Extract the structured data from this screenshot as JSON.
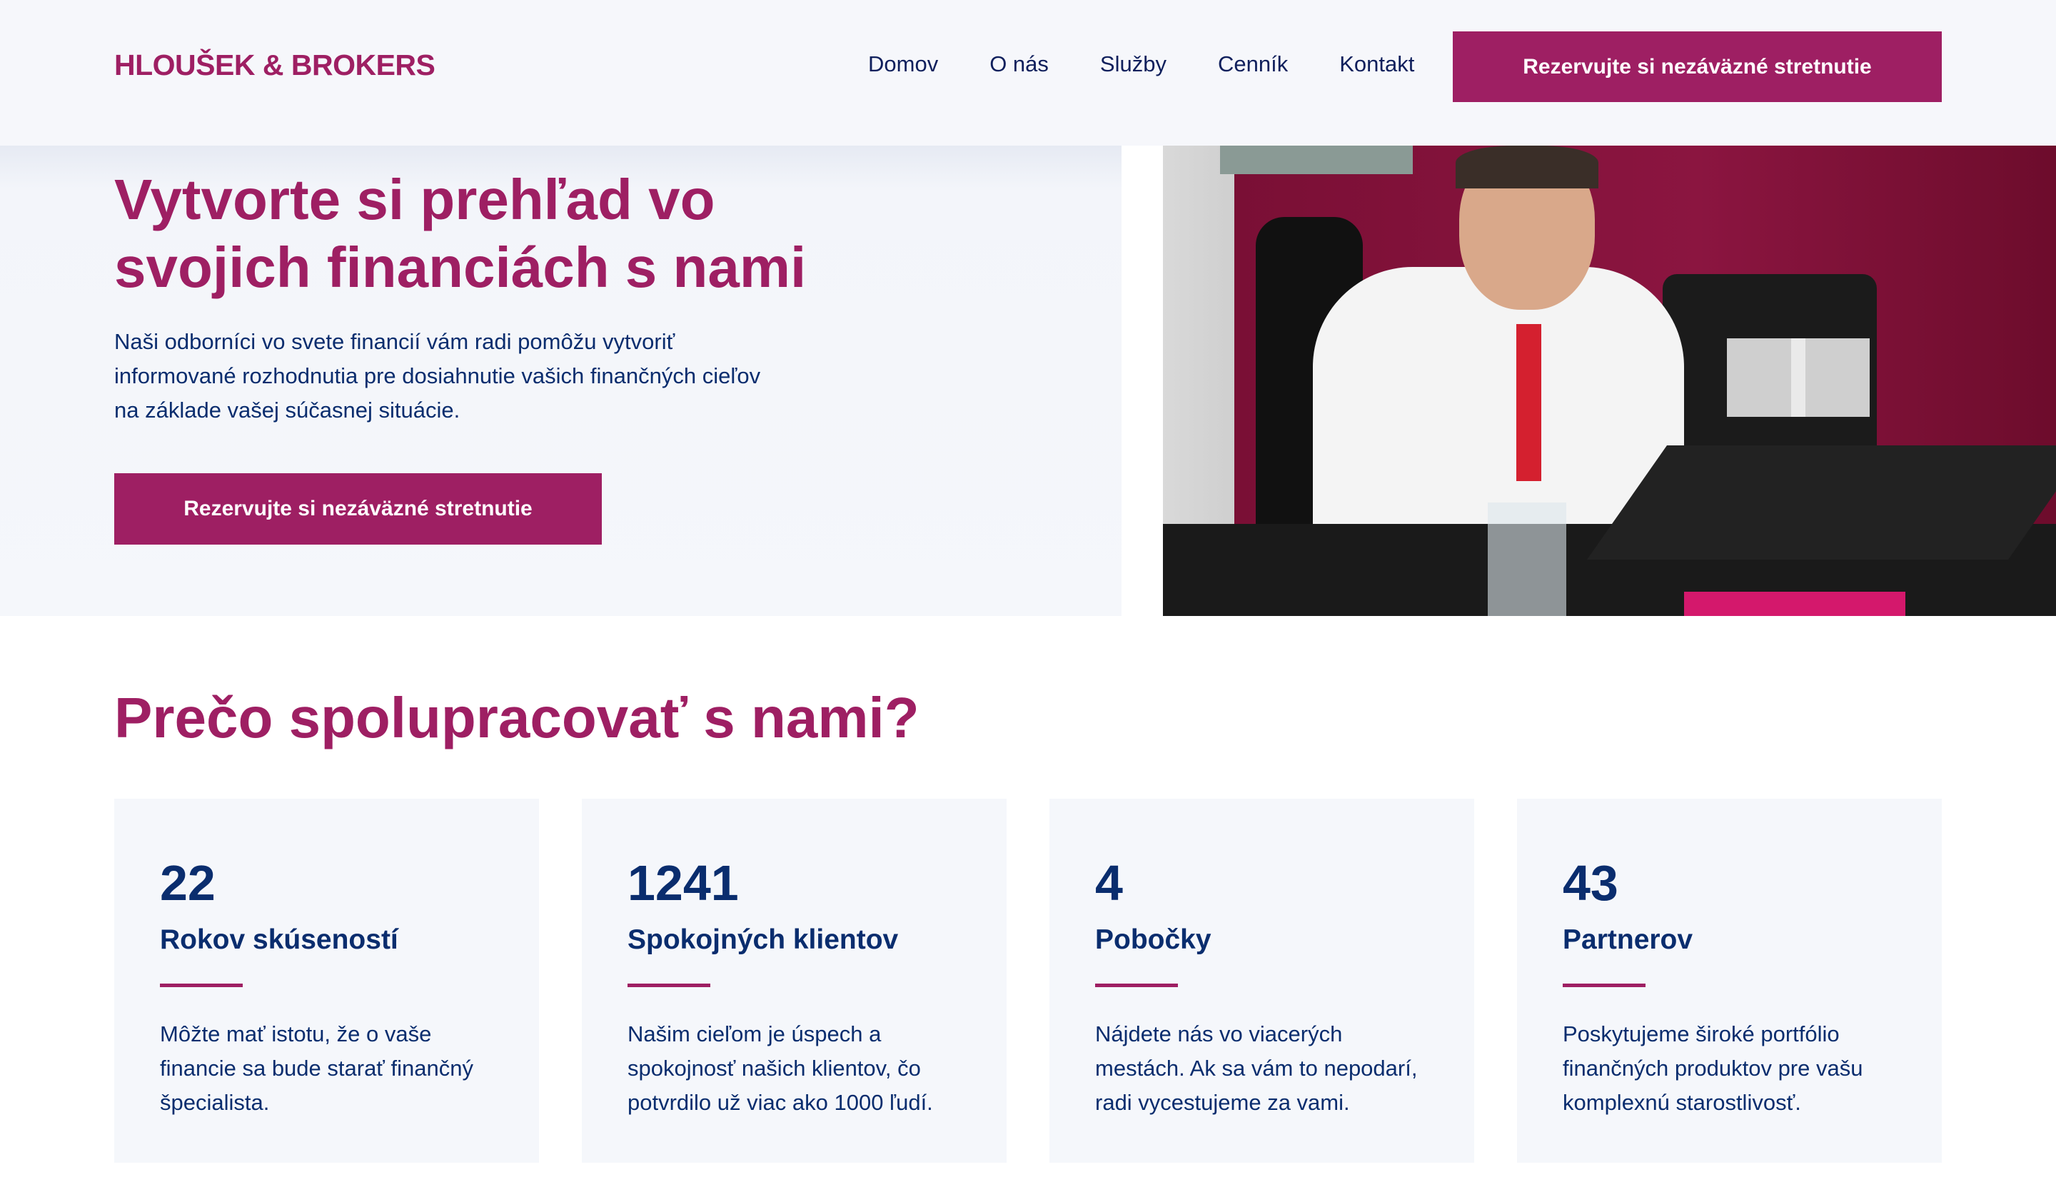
{
  "header": {
    "logo": "HLOUŠEK & BROKERS",
    "nav": [
      "Domov",
      "O nás",
      "Služby",
      "Cenník",
      "Kontakt"
    ],
    "cta": "Rezervujte si nezáväzné stretnutie"
  },
  "hero": {
    "title": "Vytvorte si prehľad vo svojich financiách s nami",
    "text": "Naši odborníci vo svete financií vám radi pomôžu vytvoriť informované rozhodnutia pre dosiahnutie vašich finančných cieľov na základe vašej súčasnej situácie.",
    "cta": "Rezervujte si nezáväzné stretnutie"
  },
  "why": {
    "title": "Prečo spolupracovať s nami?",
    "cards": [
      {
        "number": "22",
        "title": "Rokov skúseností",
        "text": "Môžte mať istotu, že o vaše financie sa bude starať finančný špecialista."
      },
      {
        "number": "1241",
        "title": "Spokojných klientov",
        "text": "Našim cieľom je úspech a spokojnosť našich klientov, čo potvrdilo už viac ako 1000 ľudí."
      },
      {
        "number": "4",
        "title": "Pobočky",
        "text": "Nájdete nás vo viacerých mestách. Ak sa vám to nepodarí, radi vycestujeme za vami."
      },
      {
        "number": "43",
        "title": "Partnerov",
        "text": "Poskytujeme široké portfólio finančných produktov pre vašu komplexnú starostlivosť."
      }
    ]
  },
  "colors": {
    "accent": "#9e1f63",
    "text": "#0a2d6e"
  }
}
